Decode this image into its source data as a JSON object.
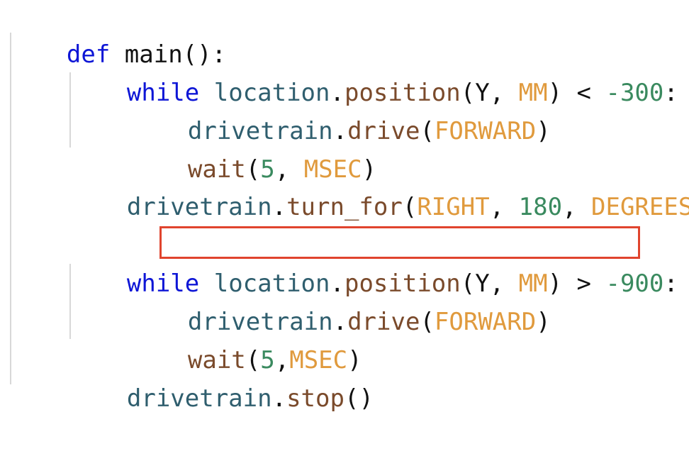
{
  "code": {
    "l1": {
      "kw": "def",
      "name": " main",
      "rest": "():"
    },
    "l2": {
      "kw": "while",
      "obj": "location",
      "dot": ".",
      "fn": "position",
      "p1": "(Y, ",
      "c1": "MM",
      "p2": ") < ",
      "num": "-300",
      "end": ":"
    },
    "l3": {
      "obj": "drivetrain",
      "dot": ".",
      "fn": "drive",
      "p1": "(",
      "c1": "FORWARD",
      "p2": ")"
    },
    "l4": {
      "fn": "wait",
      "p1": "(",
      "n1": "5",
      "p2": ", ",
      "c1": "MSEC",
      "p3": ")"
    },
    "l5": {
      "obj": "drivetrain",
      "dot": ".",
      "fn": "turn_for",
      "p1": "(",
      "c1": "RIGHT",
      "p2": ", ",
      "n1": "180",
      "p3": ", ",
      "c2": "DEGREES",
      "p4": ")"
    },
    "l6": {
      "kw": "while",
      "obj": "location",
      "dot": ".",
      "fn": "position",
      "p1": "(Y, ",
      "c1": "MM",
      "p2": ") > ",
      "num": "-900",
      "end": ":"
    },
    "l7": {
      "obj": "drivetrain",
      "dot": ".",
      "fn": "drive",
      "p1": "(",
      "c1": "FORWARD",
      "p2": ")"
    },
    "l8": {
      "fn": "wait",
      "p1": "(",
      "n1": "5",
      "p2": ",",
      "c1": "MSEC",
      "p3": ")"
    },
    "l9": {
      "obj": "drivetrain",
      "dot": ".",
      "fn": "stop",
      "p1": "()"
    }
  },
  "colors": {
    "keyword": "#0e16d6",
    "object": "#2f5e6e",
    "function": "#7a4a2b",
    "constant": "#e09a3d",
    "number": "#3a8a5f",
    "highlight_border": "#e0442e"
  }
}
